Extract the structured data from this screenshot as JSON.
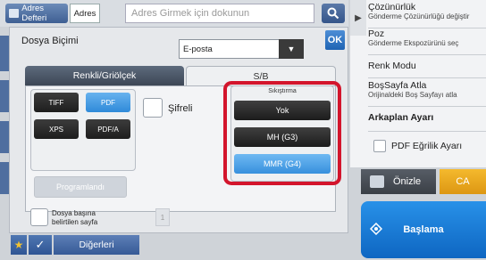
{
  "topbar": {
    "address_book_label": "Adres Defteri",
    "address_label": "Adres",
    "address_placeholder": "Adres Girmek için dokunun",
    "search_icon": "search-icon"
  },
  "panel": {
    "format_label": "Dosya Biçimi",
    "format_value": "E-posta",
    "ok_label": "OK",
    "tabs": [
      {
        "label": "Renkli/Griölçek",
        "active": false
      },
      {
        "label": "S/B",
        "active": true
      }
    ],
    "file_types": [
      {
        "label": "TIFF",
        "selected": false
      },
      {
        "label": "PDF",
        "selected": true
      },
      {
        "label": "XPS",
        "selected": false
      },
      {
        "label": "PDF/A",
        "selected": false
      }
    ],
    "encrypt_label": "Şifreli",
    "programmed_label": "Programlandı",
    "compression": {
      "title": "Sıkıştırma",
      "options": [
        {
          "label": "Yok",
          "selected": false
        },
        {
          "label": "MH (G3)",
          "selected": false
        },
        {
          "label": "MMR (G4)",
          "selected": true
        }
      ]
    },
    "per_page_label_1": "Dosya başına",
    "per_page_label_2": "belirtilen sayfa",
    "per_page_value": "1"
  },
  "bottombar": {
    "others_label": "Diğerleri"
  },
  "right_panel": {
    "items": [
      {
        "title": "Çözünürlük",
        "subtitle": "Gönderme Çözünürlüğü değiştir"
      },
      {
        "title": "Poz",
        "subtitle": "Gönderme Ekspozürünü seç"
      },
      {
        "title": "Renk Modu",
        "subtitle": ""
      },
      {
        "title": "BoşSayfa Atla",
        "subtitle": "Orijinaldeki Boş Sayfayı atla"
      },
      {
        "title": "Arkaplan Ayarı",
        "subtitle": ""
      }
    ],
    "pdf_skew_label": "PDF Eğrilik Ayarı",
    "preview_label": "Önizle",
    "ca_label": "CA",
    "start_label": "Başlama"
  },
  "colors": {
    "selected_blue": "#3790dd",
    "highlight_red": "#d3152c",
    "start_blue": "#1a7ad6",
    "ca_orange": "#e8a11c"
  }
}
